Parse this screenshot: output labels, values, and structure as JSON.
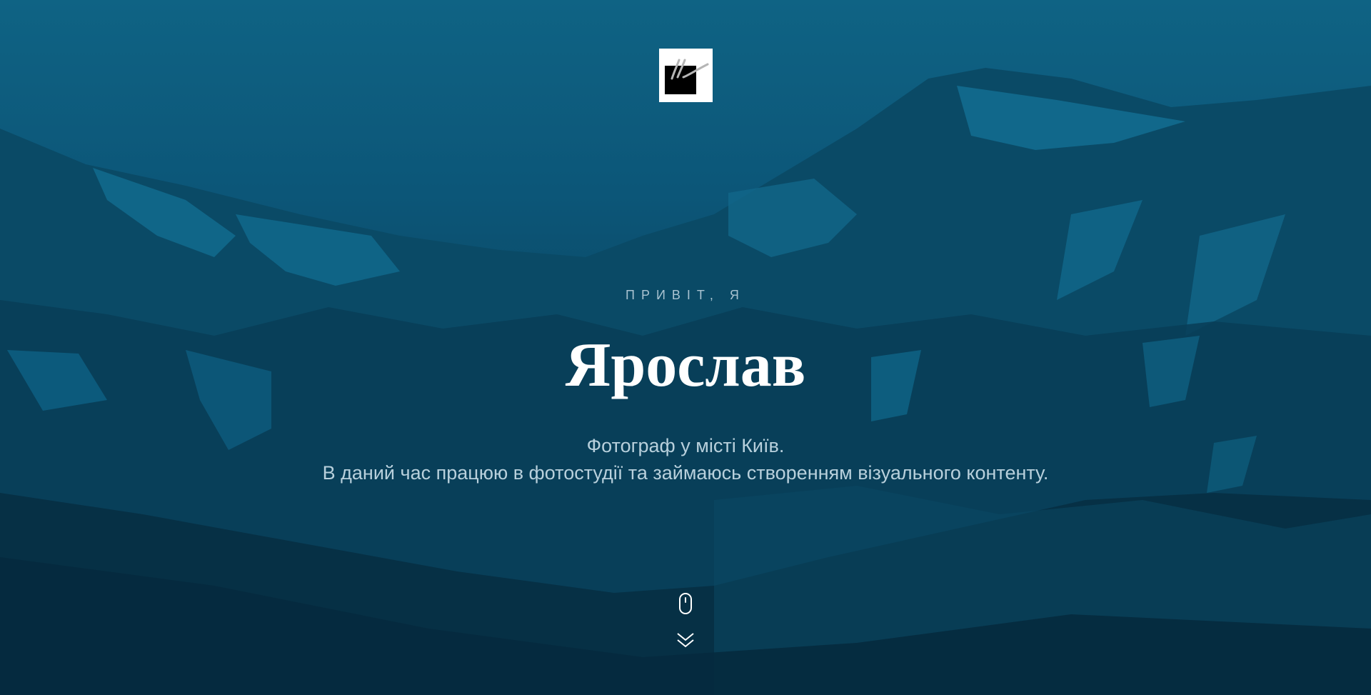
{
  "hero": {
    "greeting": "ПРИВІТ, Я",
    "name": "Ярослав",
    "description": [
      "Фотограф у місті Київ.",
      "В даний час працюю в фотостудії та займаюсь створенням візуального контенту."
    ]
  },
  "colors": {
    "overlay": "#0b4d6e",
    "heading": "#ffffff",
    "text": "#b8d0dc"
  },
  "icons": {
    "logo": "signature-logo-icon",
    "scroll": "mouse-icon",
    "scroll_down": "chevron-double-down-icon"
  }
}
